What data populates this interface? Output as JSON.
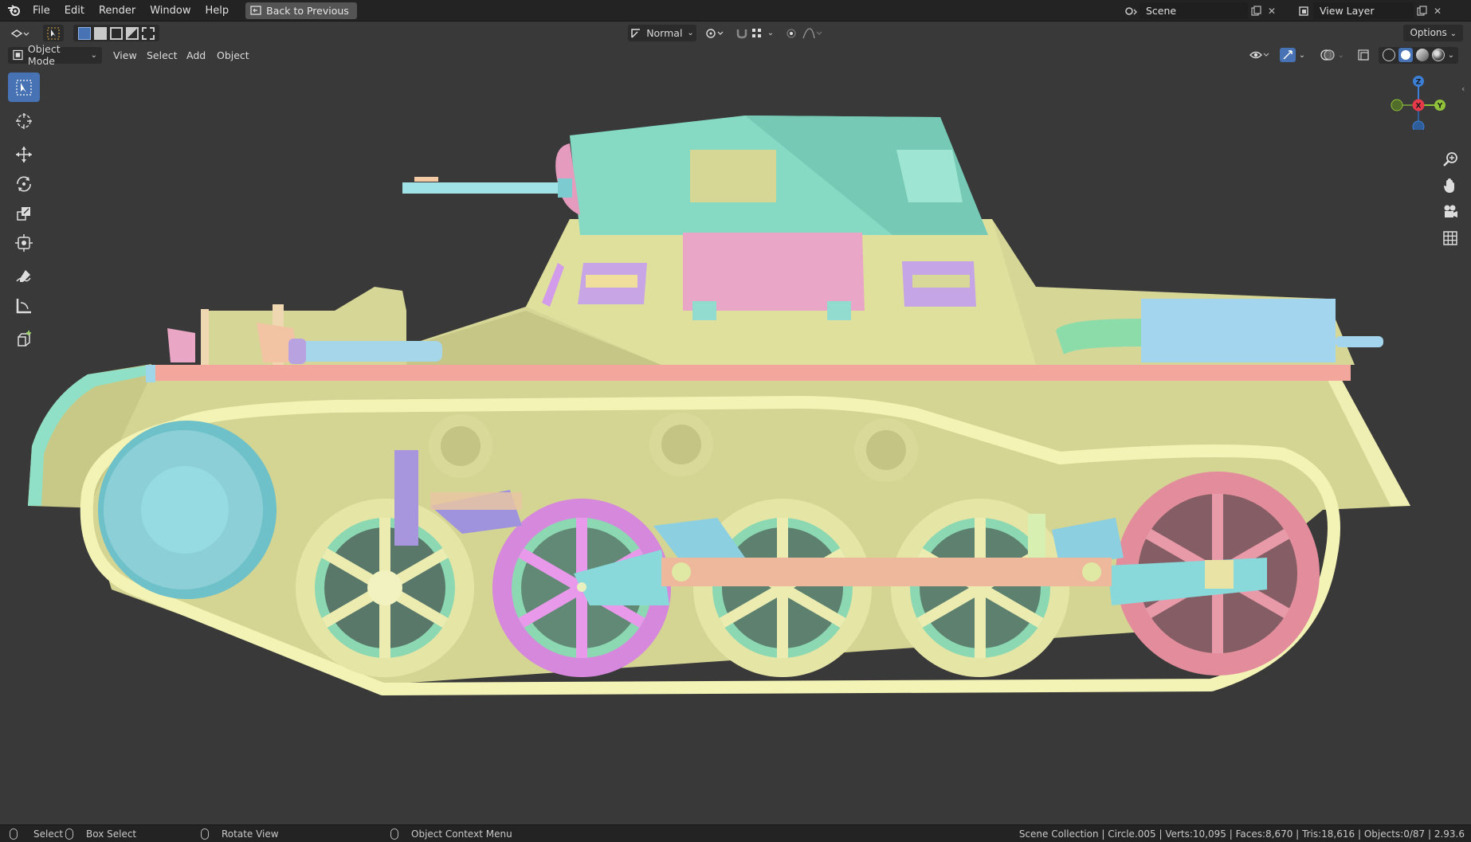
{
  "topbar": {
    "menus": [
      "File",
      "Edit",
      "Render",
      "Window",
      "Help"
    ],
    "back_button": "Back to Previous",
    "scene_name": "Scene",
    "view_layer": "View Layer"
  },
  "header": {
    "transform_orientation": "Normal",
    "options_label": "Options",
    "mode": "Object Mode",
    "menus": [
      "View",
      "Select",
      "Add",
      "Object"
    ]
  },
  "gizmo": {
    "axes": {
      "x": "X",
      "y": "Y",
      "z": "Z"
    },
    "colors": {
      "x": "#e8394b",
      "y": "#8fc23a",
      "z": "#3b7fd6"
    }
  },
  "tools": [
    "select-box",
    "cursor",
    "move",
    "rotate",
    "scale",
    "transform",
    "annotate",
    "measure",
    "add-cube"
  ],
  "statusbar": {
    "select": "Select",
    "box_select": "Box Select",
    "rotate_view": "Rotate View",
    "context_menu": "Object Context Menu",
    "stats": "Scene Collection | Circle.005 | Verts:10,095 | Faces:8,670 | Tris:18,616 | Objects:0/87 | 2.93.6"
  },
  "colors": {
    "hull": "#d8d89a",
    "turret": "#8edfc9",
    "fender": "#f0a59c",
    "track": "#f3f3b5",
    "sprocket": "#8ccfd6",
    "pink_panel": "#eba9c7",
    "exhaust": "#a8d9f0",
    "wheel_pink": "#e999ea",
    "wheel_red": "#e99aa8",
    "wheel_yellow": "#ececb0",
    "spoke_green": "#90d9b3",
    "beam": "#eeb89c",
    "arm": "#8ad8da"
  }
}
